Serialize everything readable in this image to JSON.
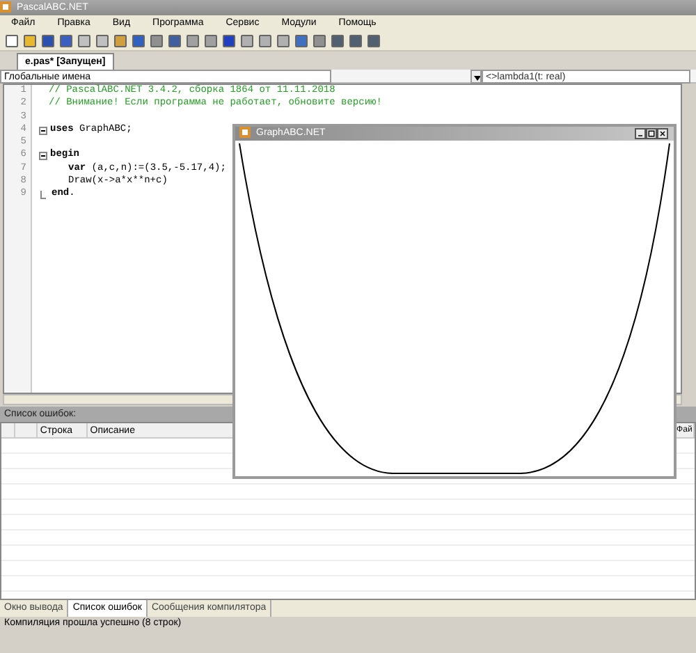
{
  "window": {
    "title": "PascalABC.NET"
  },
  "menu": [
    "Файл",
    "Правка",
    "Вид",
    "Программа",
    "Сервис",
    "Модули",
    "Помощь"
  ],
  "toolbar": [
    {
      "color": "#ffffff"
    },
    {
      "color": "#e8b830"
    },
    {
      "color": "#2a50b0"
    },
    {
      "color": "#3a5fc0"
    },
    {
      "color": "#c0c0c0"
    },
    {
      "color": "#c0c0c0"
    },
    {
      "color": "#d0a040"
    },
    {
      "color": "#3060c0"
    },
    {
      "color": "#909090"
    },
    {
      "color": "#4060a0"
    },
    {
      "color": "#a0a0a0"
    },
    {
      "color": "#a0a0a0"
    },
    {
      "color": "#2040c0"
    },
    {
      "color": "#b0b0b0"
    },
    {
      "color": "#b0b0b0"
    },
    {
      "color": "#b0b0b0"
    },
    {
      "color": "#4070c0"
    },
    {
      "color": "#909090"
    },
    {
      "color": "#506070"
    },
    {
      "color": "#506070"
    },
    {
      "color": "#506070"
    }
  ],
  "tabs": [
    {
      "label": "e.pas* [Запущен]",
      "selected": true
    }
  ],
  "scope": {
    "left": "Глобальные имена",
    "right": "<>lambda1(t: real)"
  },
  "code": [
    {
      "number": "1",
      "kind": "comment",
      "text": "// PascalABC.NET 3.4.2, сборка 1864 от 11.11.2018"
    },
    {
      "number": "2",
      "kind": "comment",
      "text": "// Внимание! Если программа не работает, обновите версию!"
    },
    {
      "number": "3",
      "kind": "blank"
    },
    {
      "number": "4",
      "kind": "fold",
      "text": "**uses** GraphABC;"
    },
    {
      "number": "5",
      "kind": "blank"
    },
    {
      "number": "6",
      "kind": "fold",
      "text": "**begin**"
    },
    {
      "number": "7",
      "kind": "plain",
      "indent": true,
      "text": "**var** (a,c,n):=(3.5,-5.17,4);"
    },
    {
      "number": "8",
      "kind": "plain",
      "indent": true,
      "text": "Draw(x->a*x**n+c)"
    },
    {
      "number": "9",
      "kind": "fold_end",
      "text": "**end**."
    }
  ],
  "errors": {
    "title": "Список ошибок:",
    "columns": [
      "Строка",
      "Описание",
      "Фай"
    ]
  },
  "bottom_tabs": [
    {
      "label": "Окно вывода",
      "selected": false
    },
    {
      "label": "Список ошибок",
      "selected": true
    },
    {
      "label": "Сообщения компилятора",
      "selected": false
    }
  ],
  "status_bar": "Компиляция прошла успешно (8 строк)",
  "graph_window": {
    "title": "GraphABC.NET"
  }
}
